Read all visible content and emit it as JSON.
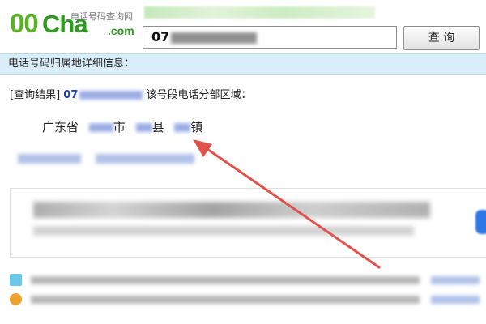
{
  "logo": {
    "prefix": "00",
    "name": "Cha",
    "suffix": ".com",
    "tagline": "电话号码查询网"
  },
  "search": {
    "value_prefix": "07",
    "button_label": "查 询"
  },
  "info_bar": {
    "title": "电话号码归属地详细信息："
  },
  "result": {
    "label": "[查询结果]",
    "number_prefix": "07",
    "suffix_text": "该号段电话分部区域：",
    "province": "广东省",
    "city_unit": "市",
    "county_unit": "县",
    "town_unit": "镇"
  },
  "colors": {
    "logo_green": "#2e9a1f",
    "info_bar_bg": "#d9eef8",
    "number_blue": "#1a3fb0",
    "arrow_red": "#e0524a"
  },
  "icons": [
    "info-icon",
    "warning-icon",
    "arrow-annotation"
  ]
}
